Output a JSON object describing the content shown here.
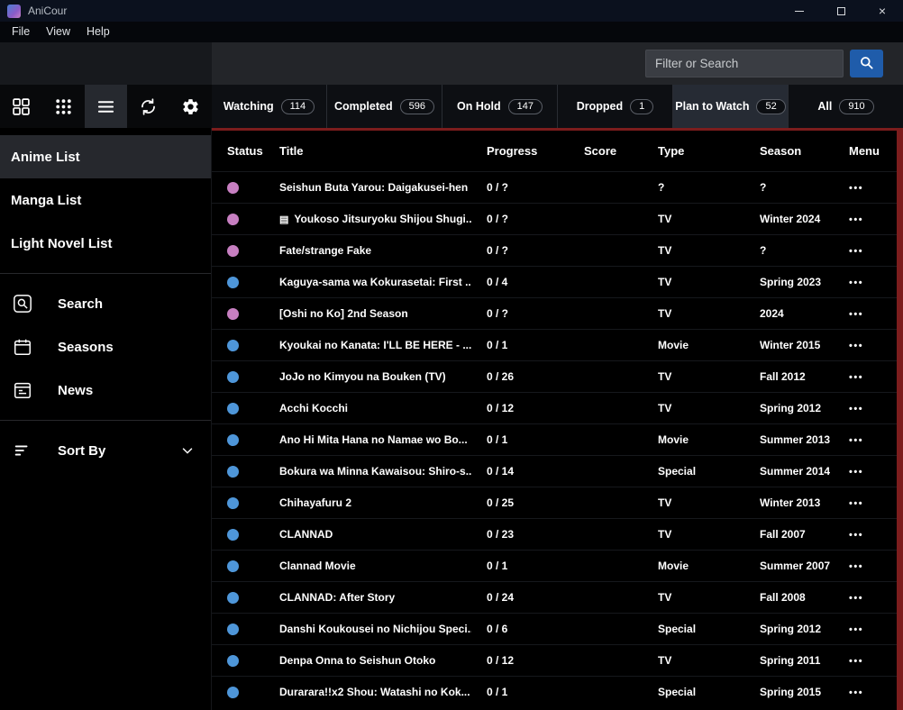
{
  "window": {
    "title": "AniCour",
    "controls": {
      "close_glyph": "×"
    }
  },
  "menu_bar": {
    "items": [
      "File",
      "View",
      "Help"
    ]
  },
  "filter": {
    "placeholder": "Filter or Search"
  },
  "sidebar": {
    "toolbar": [
      {
        "name": "card-view-button",
        "icon": "grid-icon",
        "active": false
      },
      {
        "name": "compact-view-button",
        "icon": "dots-grid-icon",
        "active": false
      },
      {
        "name": "list-view-button",
        "icon": "list-icon",
        "active": true
      },
      {
        "name": "refresh-button",
        "icon": "refresh-icon",
        "active": false
      },
      {
        "name": "settings-button",
        "icon": "gear-icon",
        "active": false
      }
    ],
    "nav_items": [
      {
        "label": "Anime List",
        "active": true
      },
      {
        "label": "Manga List",
        "active": false
      },
      {
        "label": "Light Novel List",
        "active": false
      }
    ],
    "tool_items": [
      {
        "label": "Search",
        "icon": "search-icon"
      },
      {
        "label": "Seasons",
        "icon": "calendar-icon"
      },
      {
        "label": "News",
        "icon": "news-icon"
      }
    ],
    "sort": {
      "label": "Sort By"
    }
  },
  "tabs": [
    {
      "label": "Watching",
      "count": "114",
      "active": false
    },
    {
      "label": "Completed",
      "count": "596",
      "active": false
    },
    {
      "label": "On Hold",
      "count": "147",
      "active": false
    },
    {
      "label": "Dropped",
      "count": "1",
      "active": false
    },
    {
      "label": "Plan to Watch",
      "count": "52",
      "active": true
    },
    {
      "label": "All",
      "count": "910",
      "active": false
    }
  ],
  "table": {
    "headers": [
      "Status",
      "Title",
      "Progress",
      "Score",
      "Type",
      "Season",
      "Menu"
    ],
    "menu_glyph": "•••",
    "status_colors": {
      "pink": "#c77fc1",
      "blue": "#4e96d9"
    },
    "rows": [
      {
        "status": "pink",
        "title": "Seishun Buta Yarou: Daigakusei-hen",
        "progress": "0 / ?",
        "score": "",
        "type": "?",
        "season": "?"
      },
      {
        "status": "pink",
        "title_icon": "document-icon",
        "title": "Youkoso Jitsuryoku Shijou Shugi...",
        "progress": "0 / ?",
        "score": "",
        "type": "TV",
        "season": "Winter 2024"
      },
      {
        "status": "pink",
        "title": "Fate/strange Fake",
        "progress": "0 / ?",
        "score": "",
        "type": "TV",
        "season": "?"
      },
      {
        "status": "blue",
        "title": "Kaguya-sama wa Kokurasetai: First ...",
        "progress": "0 / 4",
        "score": "",
        "type": "TV",
        "season": "Spring 2023"
      },
      {
        "status": "pink",
        "title": "[Oshi no Ko] 2nd Season",
        "progress": "0 / ?",
        "score": "",
        "type": "TV",
        "season": "2024"
      },
      {
        "status": "blue",
        "title": "Kyoukai no Kanata: I'LL BE HERE - ...",
        "progress": "0 / 1",
        "score": "",
        "type": "Movie",
        "season": "Winter 2015"
      },
      {
        "status": "blue",
        "title": "JoJo no Kimyou na Bouken (TV)",
        "progress": "0 / 26",
        "score": "",
        "type": "TV",
        "season": "Fall 2012"
      },
      {
        "status": "blue",
        "title": "Acchi Kocchi",
        "progress": "0 / 12",
        "score": "",
        "type": "TV",
        "season": "Spring 2012"
      },
      {
        "status": "blue",
        "title": "Ano Hi Mita Hana no Namae wo Bo...",
        "progress": "0 / 1",
        "score": "",
        "type": "Movie",
        "season": "Summer 2013"
      },
      {
        "status": "blue",
        "title": "Bokura wa Minna Kawaisou: Shiro-s...",
        "progress": "0 / 14",
        "score": "",
        "type": "Special",
        "season": "Summer 2014"
      },
      {
        "status": "blue",
        "title": "Chihayafuru 2",
        "progress": "0 / 25",
        "score": "",
        "type": "TV",
        "season": "Winter 2013"
      },
      {
        "status": "blue",
        "title": "CLANNAD",
        "progress": "0 / 23",
        "score": "",
        "type": "TV",
        "season": "Fall 2007"
      },
      {
        "status": "blue",
        "title": "Clannad Movie",
        "progress": "0 / 1",
        "score": "",
        "type": "Movie",
        "season": "Summer 2007"
      },
      {
        "status": "blue",
        "title": "CLANNAD: After Story",
        "progress": "0 / 24",
        "score": "",
        "type": "TV",
        "season": "Fall 2008"
      },
      {
        "status": "blue",
        "title": "Danshi Koukousei no Nichijou Speci...",
        "progress": "0 / 6",
        "score": "",
        "type": "Special",
        "season": "Spring 2012"
      },
      {
        "status": "blue",
        "title": "Denpa Onna to Seishun Otoko",
        "progress": "0 / 12",
        "score": "",
        "type": "TV",
        "season": "Spring 2011"
      },
      {
        "status": "blue",
        "title": "Durarara!!x2 Shou: Watashi no Kok...",
        "progress": "0 / 1",
        "score": "",
        "type": "Special",
        "season": "Spring 2015"
      }
    ]
  },
  "colors": {
    "accent_red": "#7c1d1d",
    "search_button_blue": "#1f5caa",
    "status_pink": "#c77fc1",
    "status_blue": "#4e96d9"
  }
}
